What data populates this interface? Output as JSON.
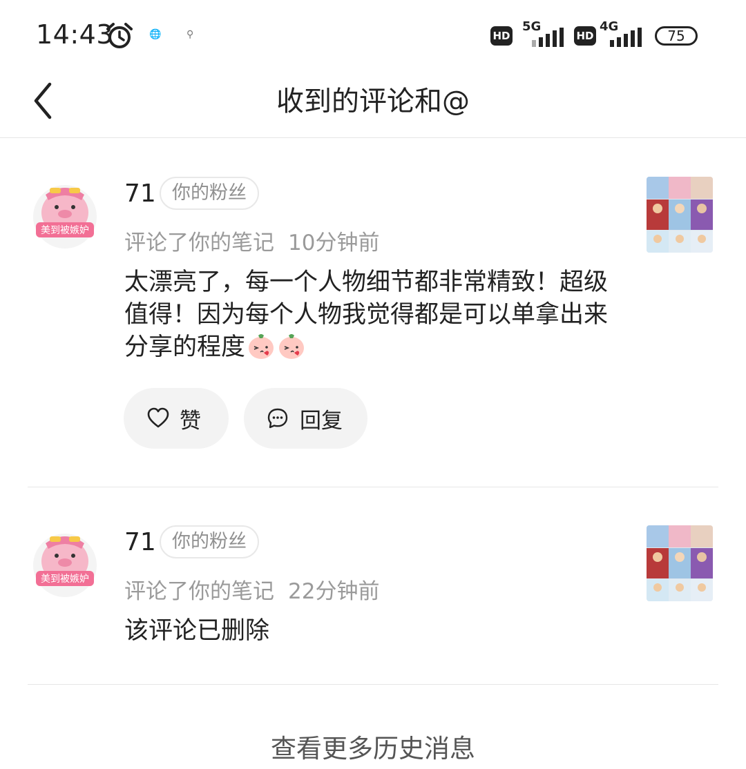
{
  "status_bar": {
    "time": "14:43",
    "icon_a": "🌐",
    "icon_b": "⚲",
    "sim1_hd": "HD",
    "sim1_network": "5G",
    "sim2_hd": "HD",
    "sim2_network": "4G",
    "battery": "75"
  },
  "header": {
    "title": "收到的评论和@",
    "back_icon": "chevron-left"
  },
  "notifications": [
    {
      "username": "71",
      "badge": "你的粉丝",
      "action": "评论了你的笔记",
      "time": "10分钟前",
      "comment_text": "太漂亮了，每一个人物细节都非常精致！超级值得！因为每个人物我觉得都是可以单拿出来分享的程度",
      "avatar_caption": "美到被嫉妒",
      "emoji_icons": [
        "blushing-peach-kiss",
        "blushing-peach-kiss"
      ]
    },
    {
      "username": "71",
      "badge": "你的粉丝",
      "action": "评论了你的笔记",
      "time": "22分钟前",
      "comment_text": "该评论已删除",
      "avatar_caption": "美到被嫉妒"
    }
  ],
  "actions": {
    "like_label": "赞",
    "reply_label": "回复",
    "like_icon": "heart-outline",
    "reply_icon": "chat-bubble-dots"
  },
  "footer": {
    "more_history": "查看更多历史消息"
  },
  "colors": {
    "text_primary": "#222222",
    "text_secondary": "#9a9a9a",
    "button_bg": "#f3f3f3",
    "divider": "#e6e6e6",
    "avatar_pink": "#f6b7c8"
  }
}
